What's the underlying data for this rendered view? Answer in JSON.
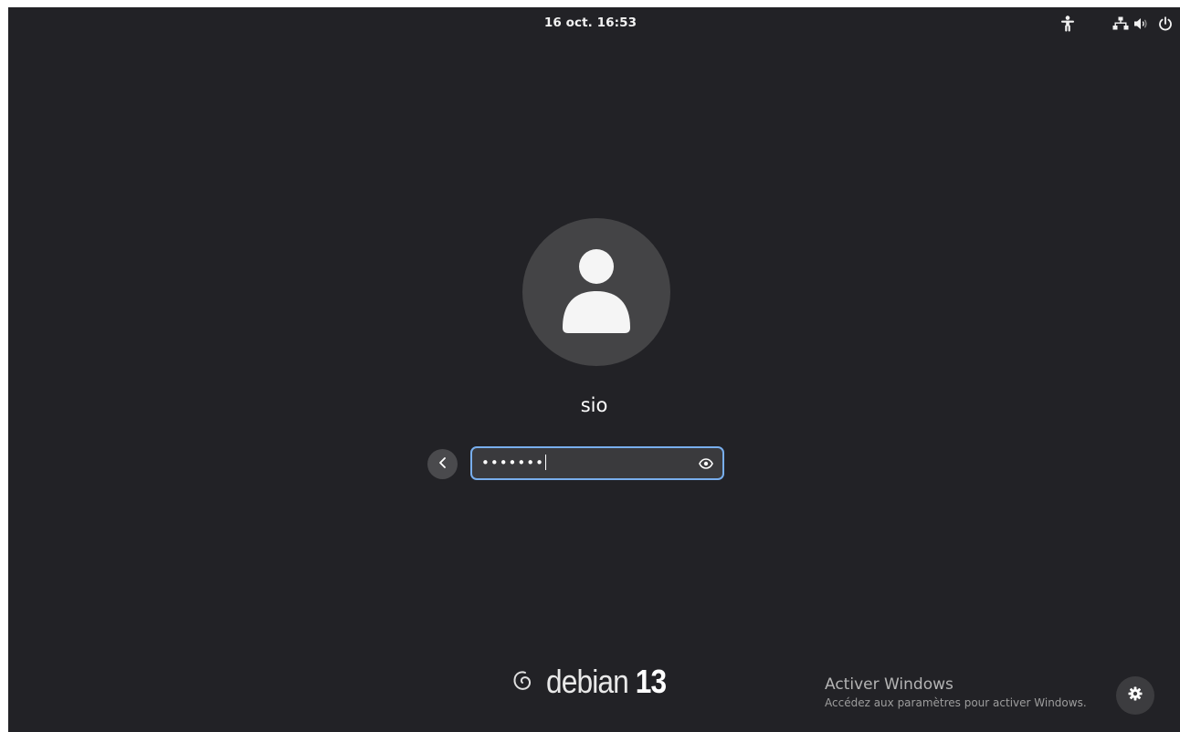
{
  "topbar": {
    "clock": "16 oct.  16:53",
    "icons": [
      "accessibility-icon",
      "network-wired-icon",
      "volume-icon",
      "power-icon"
    ]
  },
  "login": {
    "avatar_icon": "user-icon",
    "username": "sio",
    "back_icon": "chevron-left-icon",
    "password_masked": "•••••••",
    "reveal_icon": "eye-icon"
  },
  "branding": {
    "logo_icon": "debian-swirl-icon",
    "name": "debian",
    "version": "13"
  },
  "watermark": {
    "title": "Activer Windows",
    "subtitle": "Accédez aux paramètres pour activer Windows."
  },
  "session": {
    "settings_icon": "gear-icon"
  },
  "colors": {
    "background": "#222226",
    "focus_ring": "#78aeed",
    "avatar_bg": "#444446",
    "field_bg": "#3a3a3d"
  }
}
